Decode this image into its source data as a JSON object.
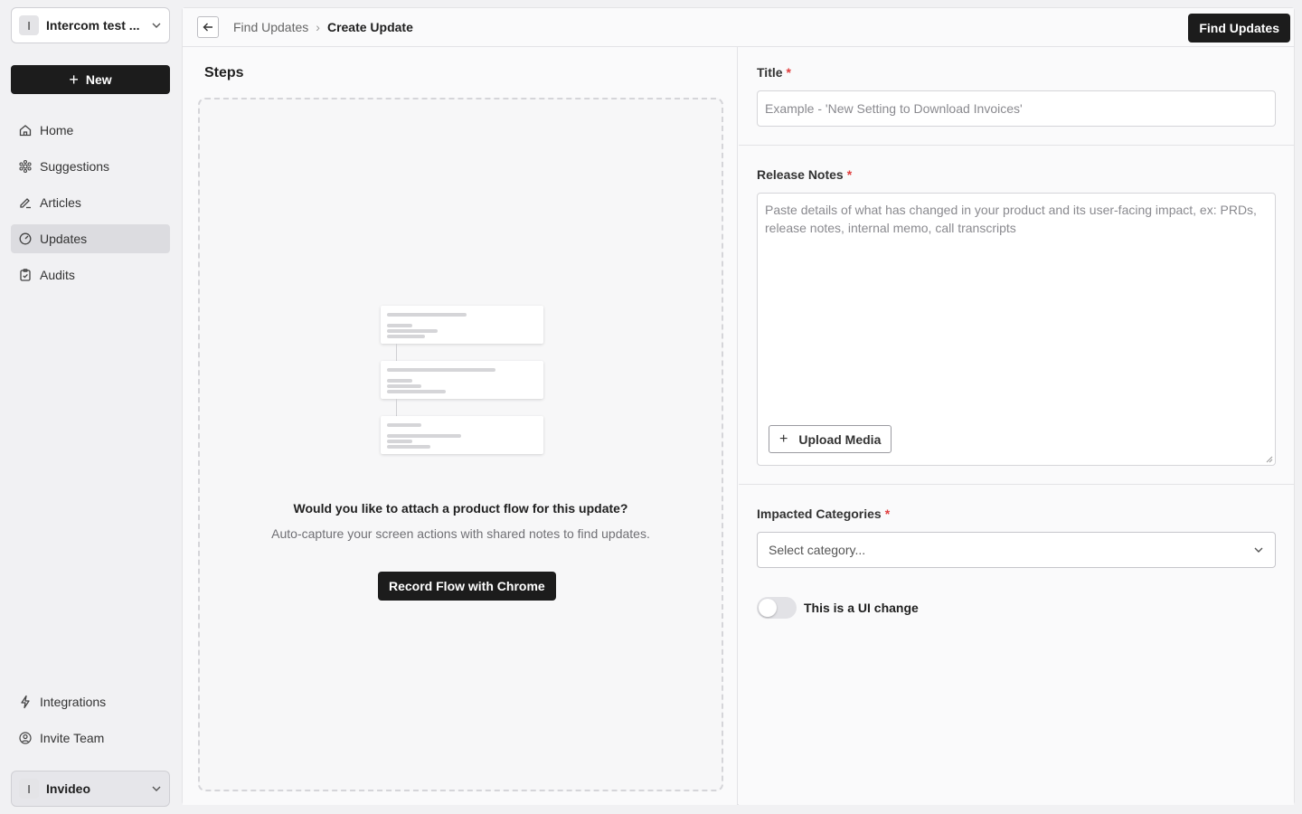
{
  "sidebar": {
    "workspace": {
      "initial": "I",
      "name": "Intercom test ..."
    },
    "new_label": "New",
    "items": [
      {
        "label": "Home",
        "icon": "home-icon",
        "active": false
      },
      {
        "label": "Suggestions",
        "icon": "sparkle-icon",
        "active": false
      },
      {
        "label": "Articles",
        "icon": "pen-icon",
        "active": false
      },
      {
        "label": "Updates",
        "icon": "gauge-icon",
        "active": true
      },
      {
        "label": "Audits",
        "icon": "clipboard-check-icon",
        "active": false
      }
    ],
    "bottom_items": [
      {
        "label": "Integrations",
        "icon": "lightning-icon"
      },
      {
        "label": "Invite Team",
        "icon": "users-icon"
      }
    ],
    "org": {
      "initial": "I",
      "name": "Invideo"
    }
  },
  "header": {
    "breadcrumb_parent": "Find Updates",
    "breadcrumb_current": "Create Update",
    "find_updates_label": "Find Updates"
  },
  "steps": {
    "title": "Steps",
    "question": "Would you like to attach a product flow for this update?",
    "subtitle": "Auto-capture your screen actions with shared notes to find updates.",
    "record_label": "Record Flow with Chrome"
  },
  "form": {
    "title_label": "Title",
    "title_placeholder": "Example - 'New Setting to Download Invoices'",
    "title_value": "",
    "notes_label": "Release Notes",
    "notes_placeholder": "Paste details of what has changed in your product and its user-facing impact, ex: PRDs, release notes, internal memo, call transcripts",
    "notes_value": "",
    "upload_label": "Upload Media",
    "categories_label": "Impacted Categories",
    "categories_value": "Select category...",
    "ui_change_label": "This is a UI change",
    "ui_change_on": false,
    "required_mark": "*"
  }
}
